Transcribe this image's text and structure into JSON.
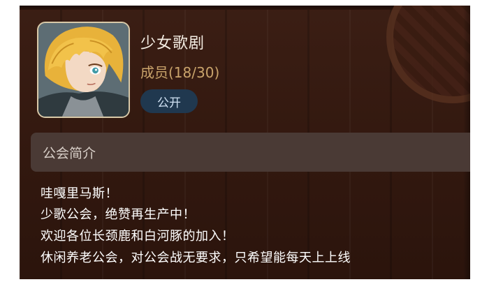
{
  "guild": {
    "name": "少女歌剧",
    "member_label": "成员",
    "member_count": "(18/30)",
    "status_badge": "公开"
  },
  "intro": {
    "section_title": "公会简介",
    "lines": [
      "哇嘎里马斯！",
      "少歌公会，绝赞再生产中！",
      "欢迎各位长颈鹿和白河豚的加入！",
      "休闲养老公会，对公会战无要求，只希望能每天上上线"
    ]
  },
  "colors": {
    "panel_bg": "#32180f",
    "accent_gold": "#c9a36b",
    "badge_bg": "#20384f",
    "section_bg": "#4a3a35"
  }
}
